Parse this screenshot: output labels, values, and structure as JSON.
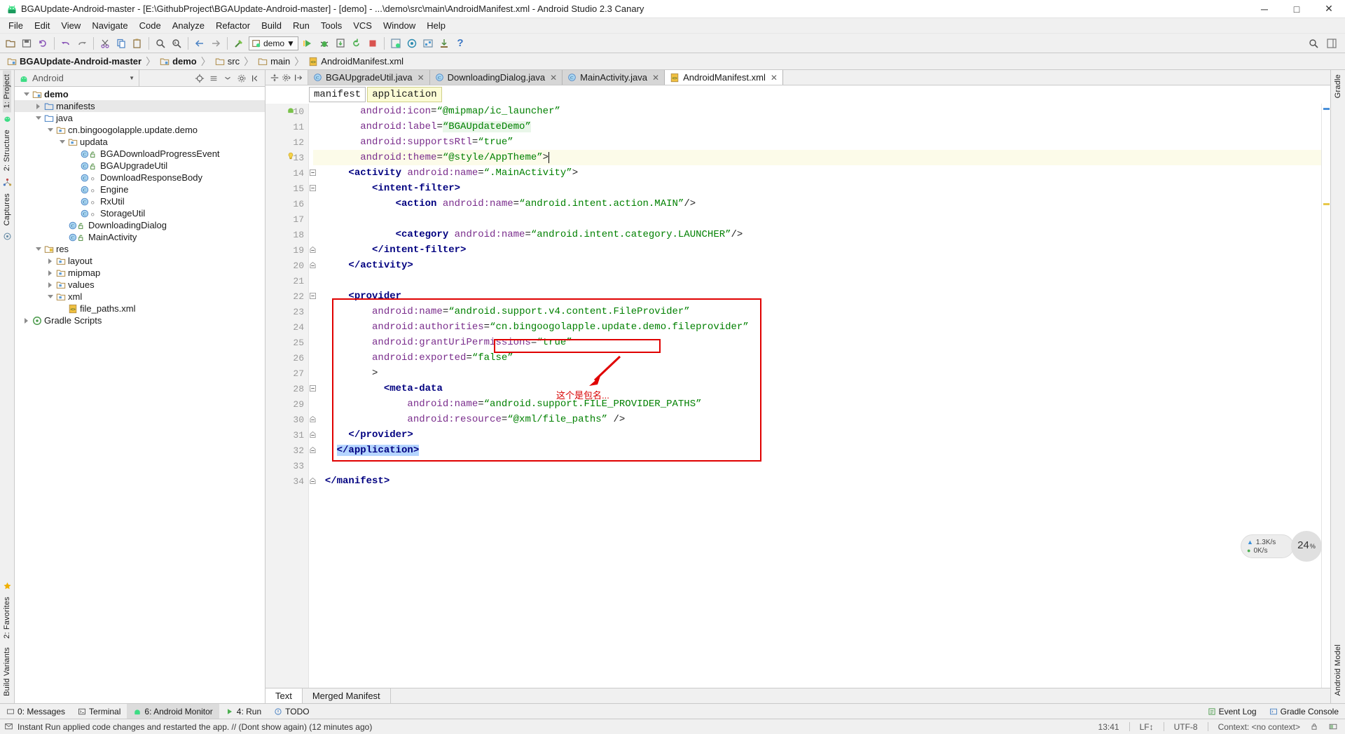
{
  "window": {
    "title": "BGAUpdate-Android-master - [E:\\GithubProject\\BGAUpdate-Android-master] - [demo] - ...\\demo\\src\\main\\AndroidManifest.xml - Android Studio 2.3 Canary",
    "minimize": "─",
    "maximize": "□",
    "close": "✕"
  },
  "menu": {
    "items": [
      "File",
      "Edit",
      "View",
      "Navigate",
      "Code",
      "Analyze",
      "Refactor",
      "Build",
      "Run",
      "Tools",
      "VCS",
      "Window",
      "Help"
    ]
  },
  "toolbar": {
    "run_config": "demo",
    "help_label": "?"
  },
  "breadcrumbs": {
    "items": [
      {
        "label": "BGAUpdate-Android-master",
        "icon": "module-icon",
        "bold": true
      },
      {
        "label": "demo",
        "icon": "module-icon",
        "bold": true
      },
      {
        "label": "src",
        "icon": "folder-icon",
        "bold": false
      },
      {
        "label": "main",
        "icon": "folder-icon",
        "bold": false
      },
      {
        "label": "AndroidManifest.xml",
        "icon": "xml-file-icon",
        "bold": false
      }
    ],
    "separator": "〉"
  },
  "rail_left": {
    "top": [
      "1: Project",
      "2: Structure",
      "Captures"
    ],
    "bottom": [
      "2: Favorites",
      "Build Variants"
    ]
  },
  "rail_right": {
    "top": [
      "Gradle"
    ],
    "bottom": [
      "Android Model"
    ]
  },
  "project_panel": {
    "combo_label": "Android",
    "tree": [
      {
        "depth": 0,
        "arrow": "open",
        "icon": "module-icon",
        "label": "demo",
        "bold": true,
        "selected": false
      },
      {
        "depth": 1,
        "arrow": "closed",
        "icon": "folder-icon",
        "label": "manifests",
        "bold": false,
        "selected": true
      },
      {
        "depth": 1,
        "arrow": "open",
        "icon": "folder-icon",
        "label": "java",
        "bold": false,
        "selected": false
      },
      {
        "depth": 2,
        "arrow": "open",
        "icon": "package-icon",
        "label": "cn.bingoogolapple.update.demo",
        "bold": false,
        "selected": false
      },
      {
        "depth": 3,
        "arrow": "open",
        "icon": "package-icon",
        "label": "updata",
        "bold": false,
        "selected": false
      },
      {
        "depth": 4,
        "arrow": "none",
        "icon": "class-public-icon",
        "label": "BGADownloadProgressEvent",
        "bold": false,
        "selected": false
      },
      {
        "depth": 4,
        "arrow": "none",
        "icon": "class-public-icon",
        "label": "BGAUpgradeUtil",
        "bold": false,
        "selected": false
      },
      {
        "depth": 4,
        "arrow": "none",
        "icon": "class-pkg-icon",
        "label": "DownloadResponseBody",
        "bold": false,
        "selected": false
      },
      {
        "depth": 4,
        "arrow": "none",
        "icon": "class-pkg-icon",
        "label": "Engine",
        "bold": false,
        "selected": false
      },
      {
        "depth": 4,
        "arrow": "none",
        "icon": "class-pkg-icon",
        "label": "RxUtil",
        "bold": false,
        "selected": false
      },
      {
        "depth": 4,
        "arrow": "none",
        "icon": "class-pkg-icon",
        "label": "StorageUtil",
        "bold": false,
        "selected": false
      },
      {
        "depth": 3,
        "arrow": "none",
        "icon": "class-public-icon",
        "label": "DownloadingDialog",
        "bold": false,
        "selected": false
      },
      {
        "depth": 3,
        "arrow": "none",
        "icon": "class-public-icon",
        "label": "MainActivity",
        "bold": false,
        "selected": false
      },
      {
        "depth": 1,
        "arrow": "open",
        "icon": "res-folder-icon",
        "label": "res",
        "bold": false,
        "selected": false
      },
      {
        "depth": 2,
        "arrow": "closed",
        "icon": "package-icon",
        "label": "layout",
        "bold": false,
        "selected": false
      },
      {
        "depth": 2,
        "arrow": "closed",
        "icon": "package-icon",
        "label": "mipmap",
        "bold": false,
        "selected": false
      },
      {
        "depth": 2,
        "arrow": "closed",
        "icon": "package-icon",
        "label": "values",
        "bold": false,
        "selected": false
      },
      {
        "depth": 2,
        "arrow": "open",
        "icon": "package-icon",
        "label": "xml",
        "bold": false,
        "selected": false
      },
      {
        "depth": 3,
        "arrow": "none",
        "icon": "xml-file-icon",
        "label": "file_paths.xml",
        "bold": false,
        "selected": false
      },
      {
        "depth": 0,
        "arrow": "closed",
        "icon": "gradle-icon",
        "label": "Gradle Scripts",
        "bold": false,
        "selected": false
      }
    ]
  },
  "editor": {
    "tabs": [
      {
        "label": "BGAUpgradeUtil.java",
        "icon": "java-class-icon",
        "active": false,
        "closable": true
      },
      {
        "label": "DownloadingDialog.java",
        "icon": "java-class-icon",
        "active": false,
        "closable": true
      },
      {
        "label": "MainActivity.java",
        "icon": "java-class-icon",
        "active": false,
        "closable": true
      },
      {
        "label": "AndroidManifest.xml",
        "icon": "xml-file-icon",
        "active": true,
        "closable": true
      }
    ],
    "xml_breadcrumb": [
      {
        "label": "manifest",
        "highlight": false
      },
      {
        "label": "application",
        "highlight": true
      }
    ],
    "bottom_tabs": [
      {
        "label": "Text",
        "active": true
      },
      {
        "label": "Merged Manifest",
        "active": false
      }
    ],
    "first_line_number": 10,
    "lines": [
      {
        "n": 10,
        "indent": 8,
        "marker": "android-icon",
        "fold": "none",
        "highlight": false,
        "segments": [
          {
            "t": "android:icon",
            "c": "attr"
          },
          {
            "t": "=",
            "c": "punc"
          },
          {
            "t": "“@mipmap/ic_launcher”",
            "c": "str"
          }
        ]
      },
      {
        "n": 11,
        "indent": 8,
        "marker": "none",
        "fold": "none",
        "highlight": false,
        "segments": [
          {
            "t": "android:label",
            "c": "attr"
          },
          {
            "t": "=",
            "c": "punc"
          },
          {
            "t": "“BGAUpdateDemo”",
            "c": "str-hl"
          }
        ]
      },
      {
        "n": 12,
        "indent": 8,
        "marker": "none",
        "fold": "none",
        "highlight": false,
        "segments": [
          {
            "t": "android:supportsRtl",
            "c": "attr"
          },
          {
            "t": "=",
            "c": "punc"
          },
          {
            "t": "“true”",
            "c": "str"
          }
        ]
      },
      {
        "n": 13,
        "indent": 8,
        "marker": "bulb-icon",
        "fold": "none",
        "highlight": true,
        "segments": [
          {
            "t": "android:theme",
            "c": "attr"
          },
          {
            "t": "=",
            "c": "punc"
          },
          {
            "t": "“@style/AppTheme”",
            "c": "str"
          },
          {
            "t": ">",
            "c": "punc"
          },
          {
            "t": "|",
            "c": "caret"
          }
        ]
      },
      {
        "n": 14,
        "indent": 6,
        "marker": "none",
        "fold": "open",
        "highlight": false,
        "segments": [
          {
            "t": "<activity ",
            "c": "tag"
          },
          {
            "t": "android:name",
            "c": "attr"
          },
          {
            "t": "=",
            "c": "punc"
          },
          {
            "t": "“.MainActivity”",
            "c": "str"
          },
          {
            "t": ">",
            "c": "punc"
          }
        ]
      },
      {
        "n": 15,
        "indent": 10,
        "marker": "none",
        "fold": "open",
        "highlight": false,
        "segments": [
          {
            "t": "<intent-filter>",
            "c": "tag"
          }
        ]
      },
      {
        "n": 16,
        "indent": 14,
        "marker": "none",
        "fold": "none",
        "highlight": false,
        "segments": [
          {
            "t": "<action ",
            "c": "tag"
          },
          {
            "t": "android:name",
            "c": "attr"
          },
          {
            "t": "=",
            "c": "punc"
          },
          {
            "t": "“android.intent.action.MAIN”",
            "c": "str"
          },
          {
            "t": "/>",
            "c": "punc"
          }
        ]
      },
      {
        "n": 17,
        "indent": 0,
        "marker": "none",
        "fold": "none",
        "highlight": false,
        "segments": []
      },
      {
        "n": 18,
        "indent": 14,
        "marker": "none",
        "fold": "none",
        "highlight": false,
        "segments": [
          {
            "t": "<category ",
            "c": "tag"
          },
          {
            "t": "android:name",
            "c": "attr"
          },
          {
            "t": "=",
            "c": "punc"
          },
          {
            "t": "“android.intent.category.LAUNCHER”",
            "c": "str"
          },
          {
            "t": "/>",
            "c": "punc"
          }
        ]
      },
      {
        "n": 19,
        "indent": 10,
        "marker": "none",
        "fold": "close",
        "highlight": false,
        "segments": [
          {
            "t": "</intent-filter>",
            "c": "tag"
          }
        ]
      },
      {
        "n": 20,
        "indent": 6,
        "marker": "none",
        "fold": "close",
        "highlight": false,
        "segments": [
          {
            "t": "</activity>",
            "c": "tag"
          }
        ]
      },
      {
        "n": 21,
        "indent": 0,
        "marker": "none",
        "fold": "none",
        "highlight": false,
        "segments": []
      },
      {
        "n": 22,
        "indent": 6,
        "marker": "none",
        "fold": "open",
        "highlight": false,
        "segments": [
          {
            "t": "<provider",
            "c": "tag"
          }
        ]
      },
      {
        "n": 23,
        "indent": 10,
        "marker": "none",
        "fold": "none",
        "highlight": false,
        "segments": [
          {
            "t": "android:name",
            "c": "attr"
          },
          {
            "t": "=",
            "c": "punc"
          },
          {
            "t": "“android.support.v4.content.FileProvider”",
            "c": "str"
          }
        ]
      },
      {
        "n": 24,
        "indent": 10,
        "marker": "none",
        "fold": "none",
        "highlight": false,
        "segments": [
          {
            "t": "android:authorities",
            "c": "attr"
          },
          {
            "t": "=",
            "c": "punc"
          },
          {
            "t": "“cn.bingoogolapple.update.demo.fileprovider”",
            "c": "str"
          }
        ]
      },
      {
        "n": 25,
        "indent": 10,
        "marker": "none",
        "fold": "none",
        "highlight": false,
        "segments": [
          {
            "t": "android:grantUriPermissions",
            "c": "attr"
          },
          {
            "t": "=",
            "c": "punc"
          },
          {
            "t": "“true”",
            "c": "str"
          }
        ]
      },
      {
        "n": 26,
        "indent": 10,
        "marker": "none",
        "fold": "none",
        "highlight": false,
        "segments": [
          {
            "t": "android:exported",
            "c": "attr"
          },
          {
            "t": "=",
            "c": "punc"
          },
          {
            "t": "“false”",
            "c": "str"
          }
        ]
      },
      {
        "n": 27,
        "indent": 10,
        "marker": "none",
        "fold": "none",
        "highlight": false,
        "segments": [
          {
            "t": ">",
            "c": "punc"
          }
        ]
      },
      {
        "n": 28,
        "indent": 12,
        "marker": "none",
        "fold": "open",
        "highlight": false,
        "segments": [
          {
            "t": "<meta-data",
            "c": "tag"
          }
        ]
      },
      {
        "n": 29,
        "indent": 16,
        "marker": "none",
        "fold": "none",
        "highlight": false,
        "segments": [
          {
            "t": "android:name",
            "c": "attr"
          },
          {
            "t": "=",
            "c": "punc"
          },
          {
            "t": "“android.support.FILE_PROVIDER_PATHS”",
            "c": "str"
          }
        ]
      },
      {
        "n": 30,
        "indent": 16,
        "marker": "none",
        "fold": "close",
        "highlight": false,
        "segments": [
          {
            "t": "android:resource",
            "c": "attr"
          },
          {
            "t": "=",
            "c": "punc"
          },
          {
            "t": "“@xml/file_paths”",
            "c": "str"
          },
          {
            "t": " />",
            "c": "punc"
          }
        ]
      },
      {
        "n": 31,
        "indent": 6,
        "marker": "none",
        "fold": "close",
        "highlight": false,
        "segments": [
          {
            "t": "</provider>",
            "c": "tag"
          }
        ]
      },
      {
        "n": 32,
        "indent": 4,
        "marker": "none",
        "fold": "close",
        "highlight": false,
        "segments": [
          {
            "t": "</application>",
            "c": "sel"
          }
        ]
      },
      {
        "n": 33,
        "indent": 0,
        "marker": "none",
        "fold": "none",
        "highlight": false,
        "segments": []
      },
      {
        "n": 34,
        "indent": 2,
        "marker": "none",
        "fold": "close",
        "highlight": false,
        "segments": [
          {
            "t": "</manifest>",
            "c": "tag"
          }
        ]
      }
    ]
  },
  "annotation": {
    "note_text": "这个是包名...",
    "color": "#e00000"
  },
  "perf_widget": {
    "up_rate": "1.3K/s",
    "down_rate": "0K/s",
    "cpu": "24",
    "cpu_unit": "%"
  },
  "tool_windows": {
    "left": [
      {
        "label": "0: Messages",
        "icon": "messages-icon",
        "active": false
      },
      {
        "label": "Terminal",
        "icon": "terminal-icon",
        "active": false
      },
      {
        "label": "6: Android Monitor",
        "icon": "android-icon",
        "active": true
      },
      {
        "label": "4: Run",
        "icon": "run-icon",
        "active": false
      },
      {
        "label": "TODO",
        "icon": "todo-icon",
        "active": false
      }
    ],
    "right": [
      {
        "label": "Event Log",
        "icon": "event-log-icon"
      },
      {
        "label": "Gradle Console",
        "icon": "gradle-console-icon"
      }
    ]
  },
  "statusbar": {
    "message": "Instant Run applied code changes and restarted the app. // (Dont show again) (12 minutes ago)",
    "position": "13:41",
    "line_sep": "LF↕",
    "encoding": "UTF-8",
    "context": "Context: <no context>",
    "lock": "🔒"
  }
}
